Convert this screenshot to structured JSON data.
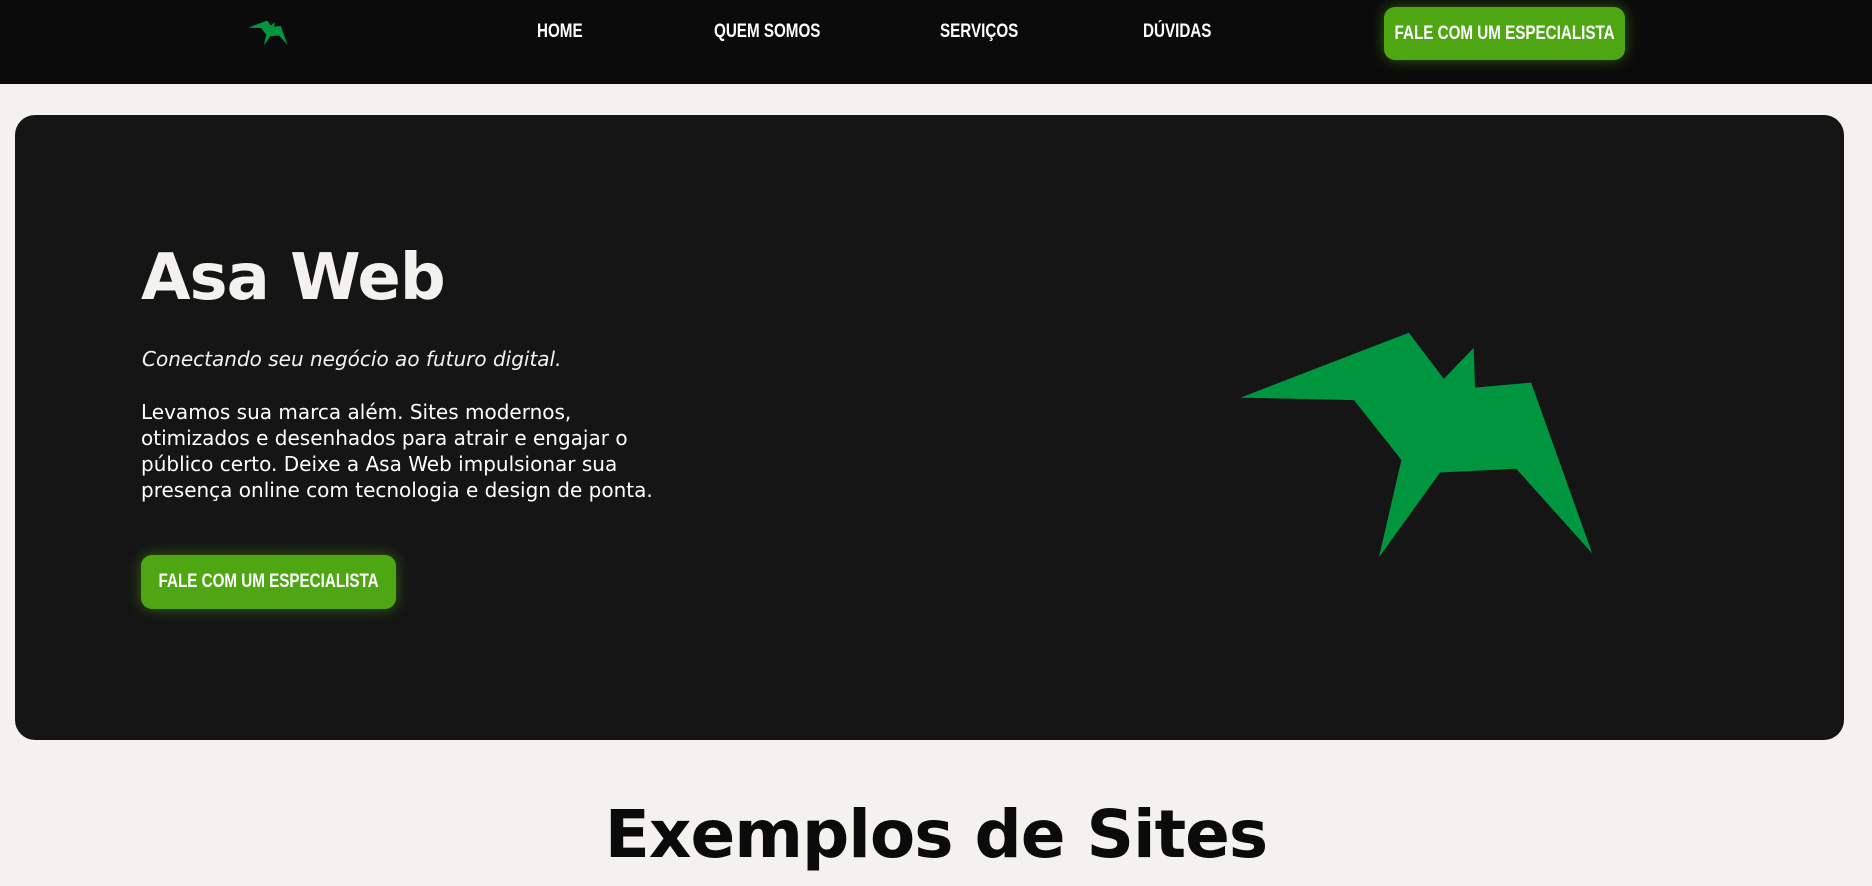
{
  "nav": {
    "logo_icon": "asa-bird-logo-icon",
    "links": [
      "HOME",
      "QUEM SOMOS",
      "SERVIÇOS",
      "DÚVIDAS"
    ],
    "cta_label": "FALE COM UM ESPECIALISTA"
  },
  "hero": {
    "title": "Asa Web",
    "tagline": "Conectando seu negócio ao futuro digital.",
    "description": "Levamos sua marca além. Sites modernos, otimizados e desenhados para atrair e engajar o público certo. Deixe a Asa Web impulsionar sua presença online com tecnologia e design de ponta.",
    "cta_label": "FALE COM UM ESPECIALISTA",
    "logo_icon": "asa-bird-logo-icon"
  },
  "examples": {
    "title": "Exemplos de Sites"
  },
  "colors": {
    "nav_background": "#0b0b0b",
    "page_background": "#f4f2ee",
    "hero_background": "#151515",
    "accent_button": "#4fa613",
    "logo_green": "#009640"
  }
}
